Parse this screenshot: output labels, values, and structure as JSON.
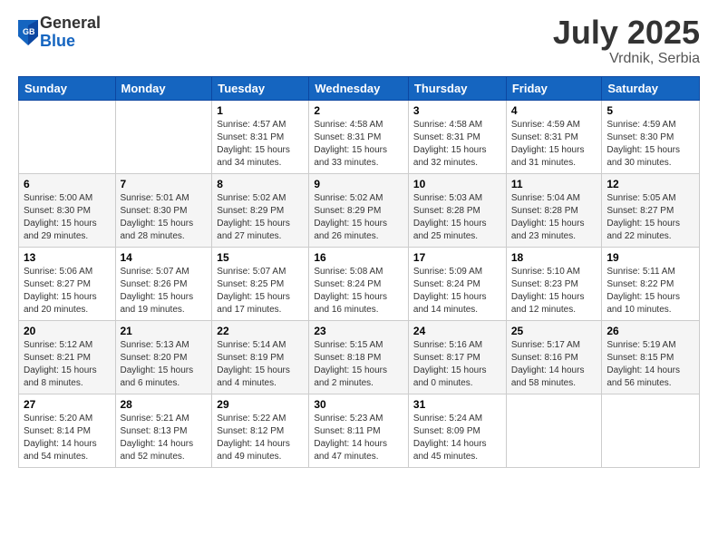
{
  "logo": {
    "general": "General",
    "blue": "Blue"
  },
  "title": "July 2025",
  "location": "Vrdnik, Serbia",
  "weekdays": [
    "Sunday",
    "Monday",
    "Tuesday",
    "Wednesday",
    "Thursday",
    "Friday",
    "Saturday"
  ],
  "weeks": [
    [
      {
        "day": "",
        "info": ""
      },
      {
        "day": "",
        "info": ""
      },
      {
        "day": "1",
        "info": "Sunrise: 4:57 AM\nSunset: 8:31 PM\nDaylight: 15 hours and 34 minutes."
      },
      {
        "day": "2",
        "info": "Sunrise: 4:58 AM\nSunset: 8:31 PM\nDaylight: 15 hours and 33 minutes."
      },
      {
        "day": "3",
        "info": "Sunrise: 4:58 AM\nSunset: 8:31 PM\nDaylight: 15 hours and 32 minutes."
      },
      {
        "day": "4",
        "info": "Sunrise: 4:59 AM\nSunset: 8:31 PM\nDaylight: 15 hours and 31 minutes."
      },
      {
        "day": "5",
        "info": "Sunrise: 4:59 AM\nSunset: 8:30 PM\nDaylight: 15 hours and 30 minutes."
      }
    ],
    [
      {
        "day": "6",
        "info": "Sunrise: 5:00 AM\nSunset: 8:30 PM\nDaylight: 15 hours and 29 minutes."
      },
      {
        "day": "7",
        "info": "Sunrise: 5:01 AM\nSunset: 8:30 PM\nDaylight: 15 hours and 28 minutes."
      },
      {
        "day": "8",
        "info": "Sunrise: 5:02 AM\nSunset: 8:29 PM\nDaylight: 15 hours and 27 minutes."
      },
      {
        "day": "9",
        "info": "Sunrise: 5:02 AM\nSunset: 8:29 PM\nDaylight: 15 hours and 26 minutes."
      },
      {
        "day": "10",
        "info": "Sunrise: 5:03 AM\nSunset: 8:28 PM\nDaylight: 15 hours and 25 minutes."
      },
      {
        "day": "11",
        "info": "Sunrise: 5:04 AM\nSunset: 8:28 PM\nDaylight: 15 hours and 23 minutes."
      },
      {
        "day": "12",
        "info": "Sunrise: 5:05 AM\nSunset: 8:27 PM\nDaylight: 15 hours and 22 minutes."
      }
    ],
    [
      {
        "day": "13",
        "info": "Sunrise: 5:06 AM\nSunset: 8:27 PM\nDaylight: 15 hours and 20 minutes."
      },
      {
        "day": "14",
        "info": "Sunrise: 5:07 AM\nSunset: 8:26 PM\nDaylight: 15 hours and 19 minutes."
      },
      {
        "day": "15",
        "info": "Sunrise: 5:07 AM\nSunset: 8:25 PM\nDaylight: 15 hours and 17 minutes."
      },
      {
        "day": "16",
        "info": "Sunrise: 5:08 AM\nSunset: 8:24 PM\nDaylight: 15 hours and 16 minutes."
      },
      {
        "day": "17",
        "info": "Sunrise: 5:09 AM\nSunset: 8:24 PM\nDaylight: 15 hours and 14 minutes."
      },
      {
        "day": "18",
        "info": "Sunrise: 5:10 AM\nSunset: 8:23 PM\nDaylight: 15 hours and 12 minutes."
      },
      {
        "day": "19",
        "info": "Sunrise: 5:11 AM\nSunset: 8:22 PM\nDaylight: 15 hours and 10 minutes."
      }
    ],
    [
      {
        "day": "20",
        "info": "Sunrise: 5:12 AM\nSunset: 8:21 PM\nDaylight: 15 hours and 8 minutes."
      },
      {
        "day": "21",
        "info": "Sunrise: 5:13 AM\nSunset: 8:20 PM\nDaylight: 15 hours and 6 minutes."
      },
      {
        "day": "22",
        "info": "Sunrise: 5:14 AM\nSunset: 8:19 PM\nDaylight: 15 hours and 4 minutes."
      },
      {
        "day": "23",
        "info": "Sunrise: 5:15 AM\nSunset: 8:18 PM\nDaylight: 15 hours and 2 minutes."
      },
      {
        "day": "24",
        "info": "Sunrise: 5:16 AM\nSunset: 8:17 PM\nDaylight: 15 hours and 0 minutes."
      },
      {
        "day": "25",
        "info": "Sunrise: 5:17 AM\nSunset: 8:16 PM\nDaylight: 14 hours and 58 minutes."
      },
      {
        "day": "26",
        "info": "Sunrise: 5:19 AM\nSunset: 8:15 PM\nDaylight: 14 hours and 56 minutes."
      }
    ],
    [
      {
        "day": "27",
        "info": "Sunrise: 5:20 AM\nSunset: 8:14 PM\nDaylight: 14 hours and 54 minutes."
      },
      {
        "day": "28",
        "info": "Sunrise: 5:21 AM\nSunset: 8:13 PM\nDaylight: 14 hours and 52 minutes."
      },
      {
        "day": "29",
        "info": "Sunrise: 5:22 AM\nSunset: 8:12 PM\nDaylight: 14 hours and 49 minutes."
      },
      {
        "day": "30",
        "info": "Sunrise: 5:23 AM\nSunset: 8:11 PM\nDaylight: 14 hours and 47 minutes."
      },
      {
        "day": "31",
        "info": "Sunrise: 5:24 AM\nSunset: 8:09 PM\nDaylight: 14 hours and 45 minutes."
      },
      {
        "day": "",
        "info": ""
      },
      {
        "day": "",
        "info": ""
      }
    ]
  ]
}
